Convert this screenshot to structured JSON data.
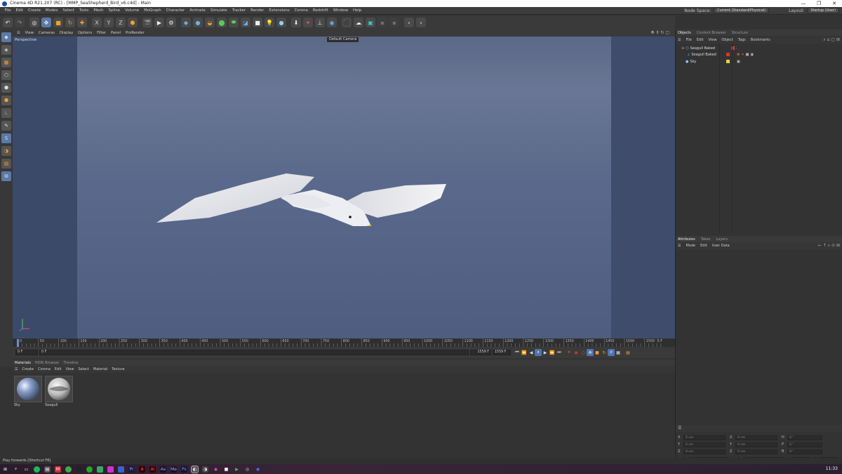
{
  "window": {
    "title": "Cinema 4D R21.207 (RC) - [MMP_SeaShepherd_Bird_v6.c4d] - Main",
    "buttons": [
      "—",
      "❐",
      "✕"
    ]
  },
  "menu": {
    "items": [
      "File",
      "Edit",
      "Create",
      "Modes",
      "Select",
      "Tools",
      "Mesh",
      "Spline",
      "Volume",
      "MoGraph",
      "Character",
      "Animate",
      "Simulate",
      "Tracker",
      "Render",
      "Extensions",
      "Corona",
      "Redshift",
      "Window",
      "Help"
    ],
    "node_space_label": "Node Space:",
    "node_space_value": "Current (Standard/Physical)",
    "layout_label": "Layout:",
    "layout_value": "Startup (User)"
  },
  "viewport": {
    "menu": [
      "View",
      "Cameras",
      "Display",
      "Options",
      "Filter",
      "Panel",
      "ProRender"
    ],
    "name": "Perspective",
    "camera": "Default Camera"
  },
  "timeline": {
    "ticks": [
      "0",
      "50",
      "100",
      "150",
      "200",
      "250",
      "300",
      "350",
      "400",
      "450",
      "500",
      "550",
      "600",
      "650",
      "700",
      "750",
      "800",
      "850",
      "900",
      "950",
      "1000",
      "1050",
      "1100",
      "1150",
      "1200",
      "1250",
      "1300",
      "1350",
      "1400",
      "1450",
      "1500",
      "1550"
    ],
    "end_label": "5 F"
  },
  "playback": {
    "current_frame": "0 F",
    "start_frame": "0 F",
    "end_frame": "1559 F",
    "end_frame2": "1559 F"
  },
  "materials": {
    "tabs": [
      "Materials",
      "HDRI Browser",
      "Timeline"
    ],
    "menu": [
      "Create",
      "Corona",
      "Edit",
      "View",
      "Select",
      "Material",
      "Texture"
    ],
    "items": [
      {
        "name": "Sky"
      },
      {
        "name": "Seagull"
      }
    ]
  },
  "objects": {
    "tabs": [
      "Objects",
      "Content Browser",
      "Structure"
    ],
    "menu": [
      "File",
      "Edit",
      "View",
      "Object",
      "Tags",
      "Bookmarks"
    ],
    "rows": [
      {
        "name": "Seagull Baked",
        "color": "#e03030"
      },
      {
        "name": "Seagull Baked",
        "color": "#e03030"
      },
      {
        "name": "Sky",
        "color": "#e8d040"
      }
    ]
  },
  "attributes": {
    "tabs": [
      "Attributes",
      "Takes",
      "Layers"
    ],
    "menu": [
      "Mode",
      "Edit",
      "User Data"
    ],
    "coords": [
      {
        "a": "X",
        "av": "0 cm",
        "b": "X",
        "bv": "0 cm",
        "c": "H",
        "cv": "0 °"
      },
      {
        "a": "Y",
        "av": "0 cm",
        "b": "Y",
        "bv": "0 cm",
        "c": "P",
        "cv": "0 °"
      },
      {
        "a": "Z",
        "av": "0 cm",
        "b": "Z",
        "bv": "0 cm",
        "c": "B",
        "cv": "0 °"
      }
    ],
    "mode_value": "World",
    "scale_value": "Scale",
    "apply_label": "Apply"
  },
  "status": {
    "text": "Play forwards [Shortcut F8]"
  },
  "taskbar": {
    "time": "11:33"
  }
}
